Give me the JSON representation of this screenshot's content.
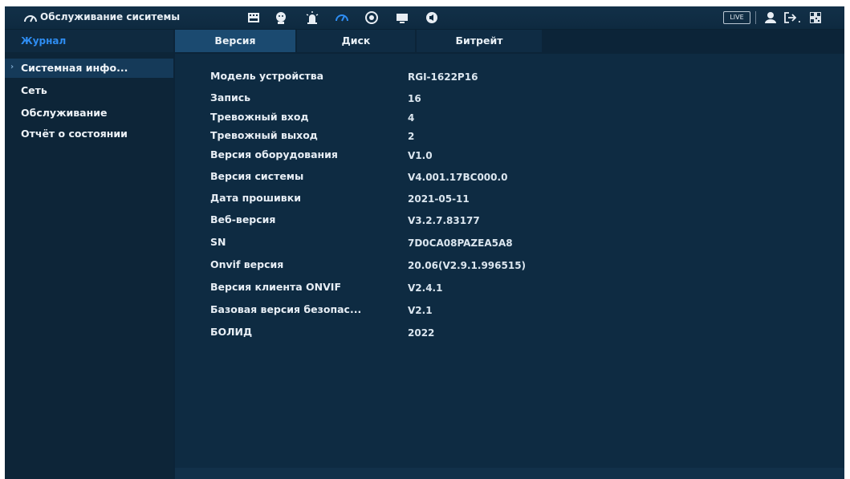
{
  "topbar": {
    "title": "Обслуживание сиситемы",
    "icons": [
      "speedometer-icon",
      "film-icon",
      "face-icon",
      "alarm-light-icon",
      "speedometer-active-icon",
      "disc-icon",
      "monitor-icon",
      "speaker-icon"
    ],
    "live_label": "LIVE",
    "right_icons": [
      "user-icon",
      "logout-icon",
      "qr-code-icon"
    ],
    "accent": "#2e8df2"
  },
  "sidebar": {
    "journal": "Журнал",
    "items": [
      {
        "label": "Системная инфо..."
      },
      {
        "label": "Сеть"
      },
      {
        "label": "Обслуживание"
      },
      {
        "label": "Отчёт о состоянии"
      }
    ]
  },
  "tabs": [
    {
      "label": "Версия"
    },
    {
      "label": "Диск"
    },
    {
      "label": "Битрейт"
    }
  ],
  "info": [
    {
      "key": "Модель устройства",
      "value": "RGI-1622P16"
    },
    {
      "key": "Запись",
      "value": "16"
    },
    {
      "key": "Тревожный вход",
      "value": "4"
    },
    {
      "key": "Тревожный выход",
      "value": "2"
    },
    {
      "key": "Версия оборудования",
      "value": "V1.0"
    },
    {
      "key": "Версия системы",
      "value": "V4.001.17BC000.0"
    },
    {
      "key": "Дата прошивки",
      "value": "2021-05-11"
    },
    {
      "key": "Веб-версия",
      "value": "V3.2.7.83177"
    },
    {
      "key": "SN",
      "value": "7D0CA08PAZEA5A8"
    },
    {
      "key": "Onvif версия",
      "value": "20.06(V2.9.1.996515)"
    },
    {
      "key": "Версия клиента ONVIF",
      "value": "V2.4.1"
    },
    {
      "key": "Базовая версия безопас...",
      "value": "V2.1"
    },
    {
      "key": "БОЛИД",
      "value": "2022"
    }
  ]
}
